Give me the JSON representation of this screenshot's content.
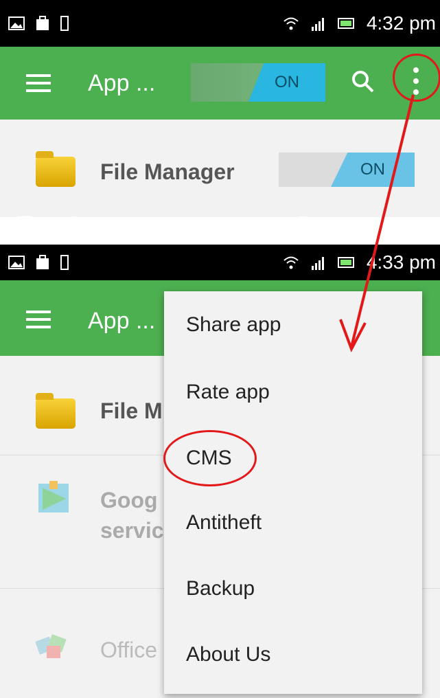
{
  "top_screen": {
    "status_time": "4:32 pm",
    "app_title": "App ...",
    "toggle_label": "ON",
    "file_manager_label": "File Manager",
    "file_manager_toggle": "ON"
  },
  "bottom_screen": {
    "status_time": "4:33 pm",
    "app_title": "App ...",
    "rows": [
      {
        "label": "File M"
      },
      {
        "label": "Goog"
      },
      {
        "label": "servic"
      },
      {
        "label": "Office"
      }
    ]
  },
  "overflow_menu": {
    "items": [
      "Share app",
      "Rate app",
      "CMS",
      "Antitheft",
      "Backup",
      "About Us"
    ]
  },
  "annotations": {
    "highlight_color": "#e31818",
    "icons": [
      "overflow-menu-icon",
      "search-icon",
      "hamburger-icon",
      "wifi-icon",
      "signal-icon",
      "battery-icon"
    ]
  }
}
